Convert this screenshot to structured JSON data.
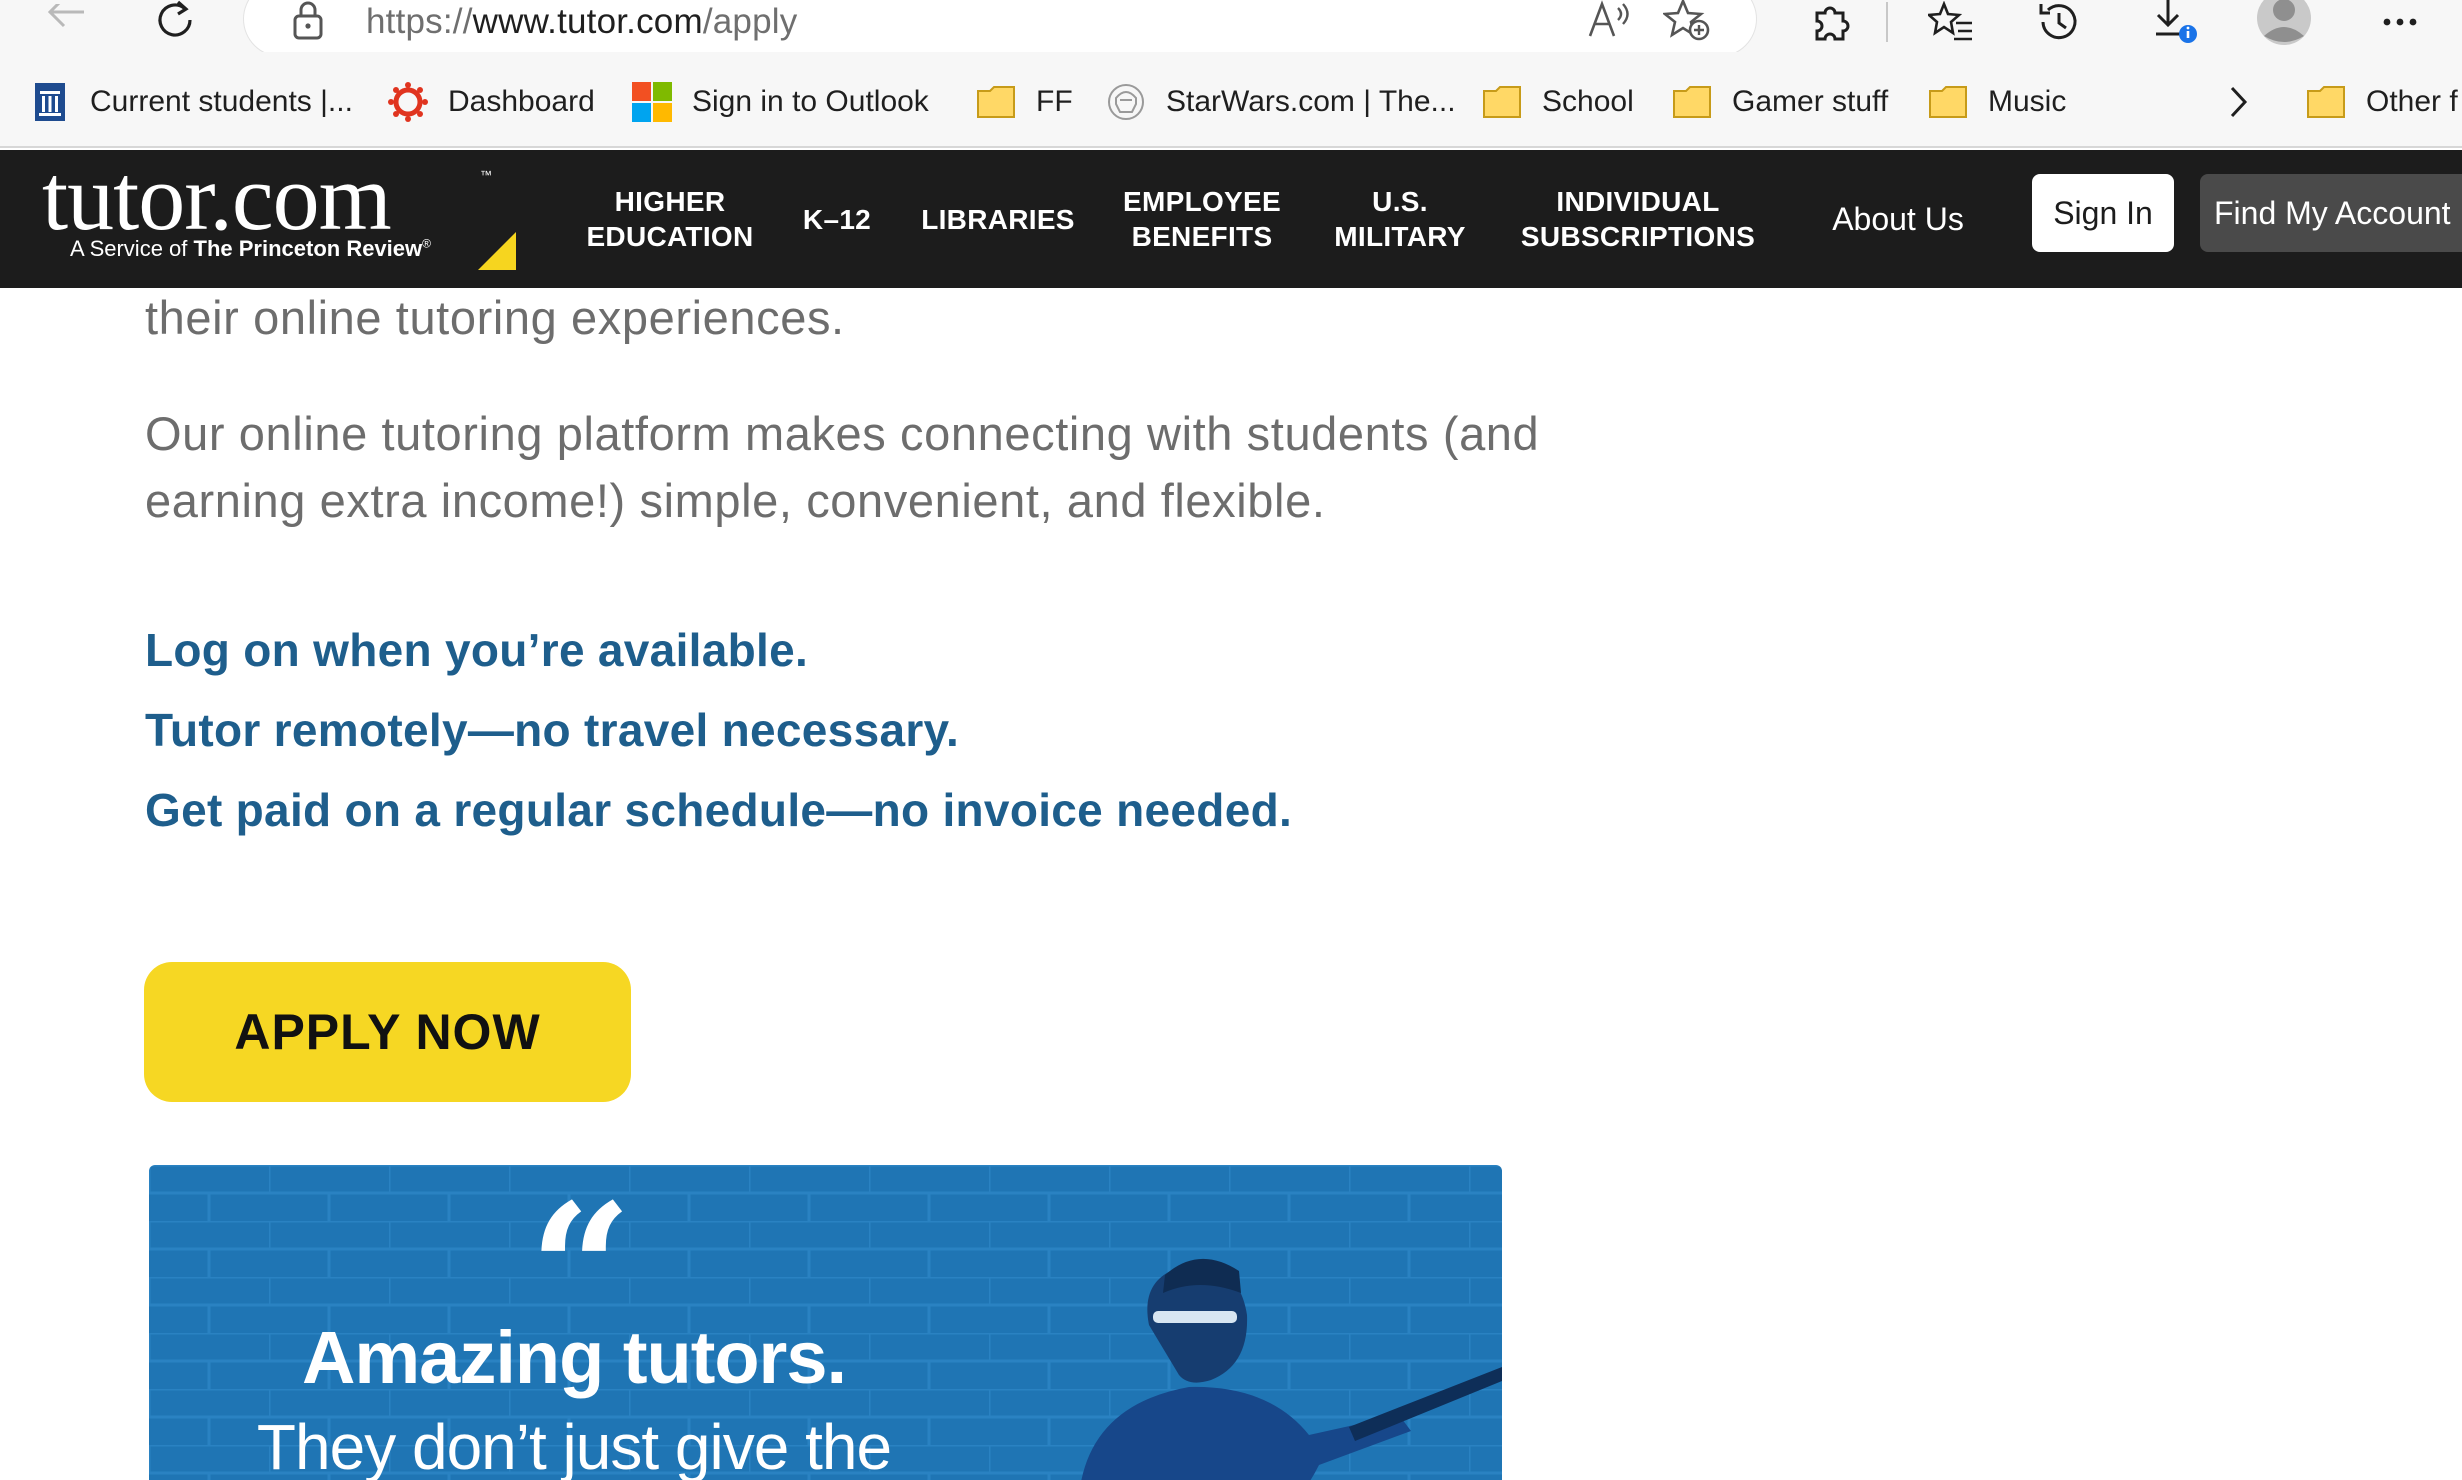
{
  "browser": {
    "url_prefix": "https://",
    "url_host": "www.tutor.com",
    "url_path": "/apply",
    "bookmarks": [
      {
        "label": "Current students |...",
        "icon": "university-icon"
      },
      {
        "label": "Dashboard",
        "icon": "canvas-icon"
      },
      {
        "label": "Sign in to Outlook",
        "icon": "microsoft-icon"
      },
      {
        "label": "FF",
        "icon": "folder-icon"
      },
      {
        "label": "StarWars.com | The...",
        "icon": "starwars-icon"
      },
      {
        "label": "School",
        "icon": "folder-icon"
      },
      {
        "label": "Gamer stuff",
        "icon": "folder-icon"
      },
      {
        "label": "Music",
        "icon": "folder-icon"
      },
      {
        "label": "Other f",
        "icon": "folder-icon"
      }
    ]
  },
  "header": {
    "logo_word": "tutor.com",
    "logo_tm": "™",
    "logo_service": "A Service of ",
    "logo_brand": "The Princeton Review",
    "logo_reg": "®",
    "nav": [
      "HIGHER\nEDUCATION",
      "K–12",
      "LIBRARIES",
      "EMPLOYEE\nBENEFITS",
      "U.S.\nMILITARY",
      "INDIVIDUAL\nSUBSCRIPTIONS"
    ],
    "about": "About Us",
    "sign_in": "Sign In",
    "find_account": "Find My Account"
  },
  "content": {
    "para1_line1": "their online tutoring experiences.",
    "para2_line1": "Our online tutoring platform makes connecting with students (and",
    "para2_line2": "earning extra income!) simple, convenient, and flexible.",
    "benefits": [
      "Log on when you’re available.",
      "Tutor remotely—no travel necessary.",
      "Get paid on a regular schedule—no invoice needed."
    ],
    "apply_button": "APPLY NOW",
    "promo": {
      "quote_mark": "“",
      "headline": "Amazing tutors.",
      "subline": "They don’t just give the"
    }
  },
  "colors": {
    "header_bg": "#1c1c1c",
    "benefit_text": "#1e5e8c",
    "apply_button": "#f6d723",
    "promo_bg": "#1f75b4",
    "logo_accent": "#f6d51f"
  }
}
